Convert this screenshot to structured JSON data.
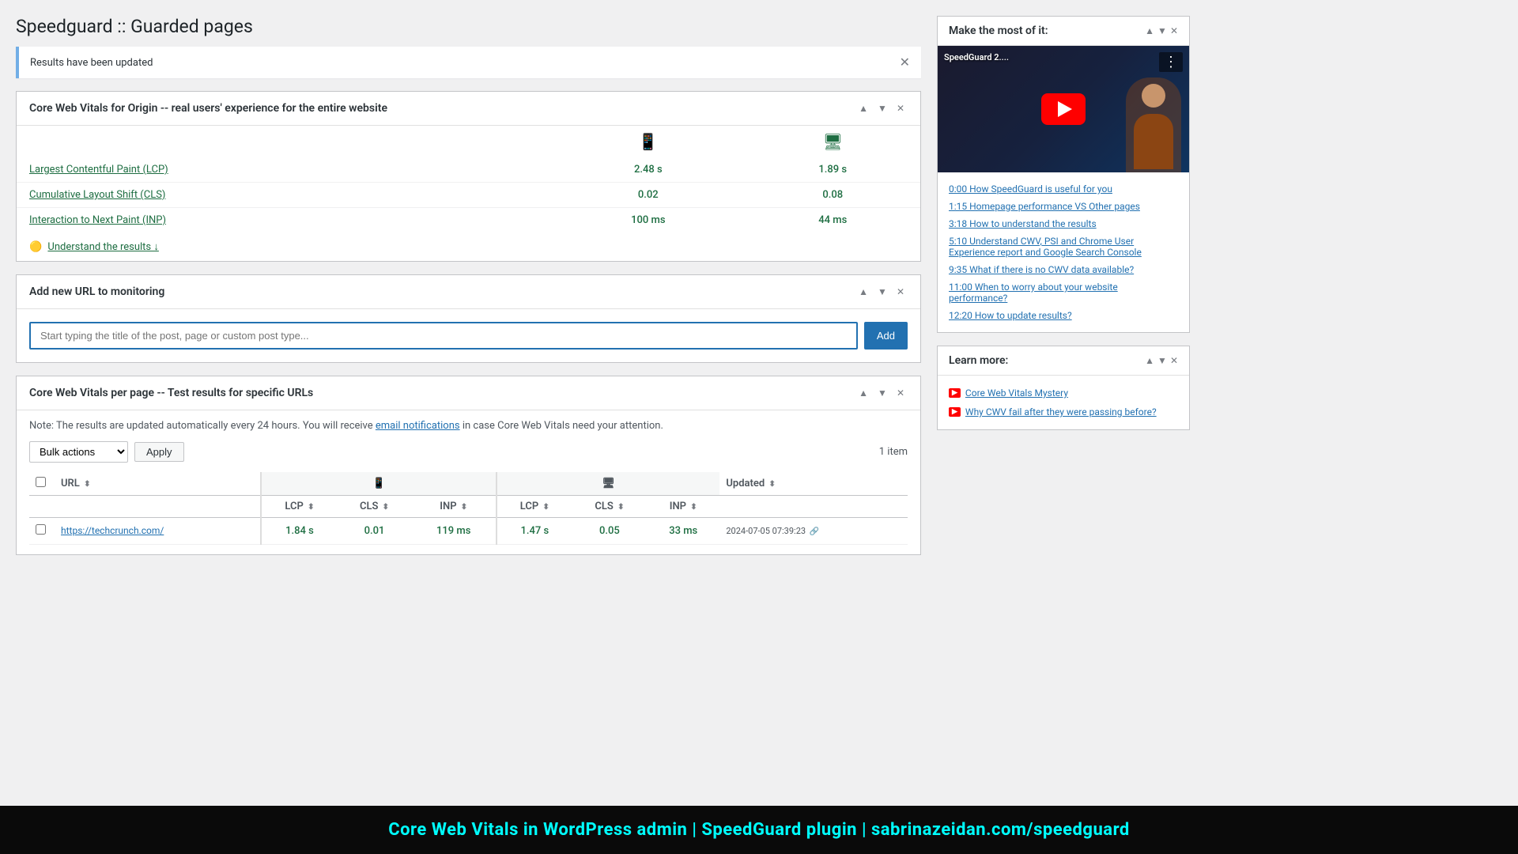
{
  "page": {
    "title": "Speedguard :: Guarded pages"
  },
  "notice": {
    "text": "Results have been updated"
  },
  "cwv_origin": {
    "section_title": "Core Web Vitals for Origin -- real users' experience for the entire website",
    "mobile_icon": "📱",
    "desktop_icon": "🖥",
    "metrics": [
      {
        "name": "Largest Contentful Paint (LCP)",
        "mobile": "2.48 s",
        "desktop": "1.89 s"
      },
      {
        "name": "Cumulative Layout Shift (CLS)",
        "mobile": "0.02",
        "desktop": "0.08"
      },
      {
        "name": "Interaction to Next Paint (INP)",
        "mobile": "100 ms",
        "desktop": "44 ms"
      }
    ],
    "understand_link": "Understand the results ↓"
  },
  "add_url": {
    "section_title": "Add new URL to monitoring",
    "input_placeholder": "Start typing the title of the post, page or custom post type...",
    "button_label": "Add"
  },
  "per_page": {
    "section_title": "Core Web Vitals per page -- Test results for specific URLs",
    "note": "Note: The results are updated automatically every 24 hours. You will receive",
    "note_link": "email notifications",
    "note_suffix": " in case Core Web Vitals need your attention.",
    "bulk_label": "Bulk actions",
    "apply_label": "Apply",
    "item_count": "1 item",
    "columns": {
      "url": "URL",
      "mobile_lcp": "LCP",
      "mobile_cls": "CLS",
      "mobile_inp": "INP",
      "desktop_lcp": "LCP",
      "desktop_cls": "CLS",
      "desktop_inp": "INP",
      "updated": "Updated"
    },
    "rows": [
      {
        "url": "https://techcrunch.com/",
        "mobile_lcp": "1.84 s",
        "mobile_cls": "0.01",
        "mobile_inp": "119 ms",
        "desktop_lcp": "1.47 s",
        "desktop_cls": "0.05",
        "desktop_inp": "33 ms",
        "updated": "2024-07-05 07:39:23"
      }
    ]
  },
  "sidebar": {
    "make_most": {
      "title": "Make the most of it:",
      "video_title": "SpeedGuard 2....",
      "toc_items": [
        {
          "time": "0:00",
          "label": "How SpeedGuard is useful for you"
        },
        {
          "time": "1:15",
          "label": "Homepage performance VS Other pages"
        },
        {
          "time": "3:18",
          "label": "How to understand the results"
        },
        {
          "time": "5:10",
          "label": "Understand CWV, PSI and Chrome User Experience report and Google Search Console"
        },
        {
          "time": "9:35",
          "label": "What if there is no CWV data available?"
        },
        {
          "time": "11:00",
          "label": "When to worry about your website performance?"
        },
        {
          "time": "12:20",
          "label": "How to update results?"
        }
      ]
    },
    "learn_more": {
      "title": "Learn more:",
      "items": [
        {
          "label": "Core Web Vitals Mystery"
        },
        {
          "label": "Why CWV fail after they were passing before?"
        }
      ]
    }
  },
  "bottom_banner": {
    "text": "Core Web Vitals in WordPress admin | SpeedGuard plugin | sabrinazeidan.com/speedguard"
  }
}
